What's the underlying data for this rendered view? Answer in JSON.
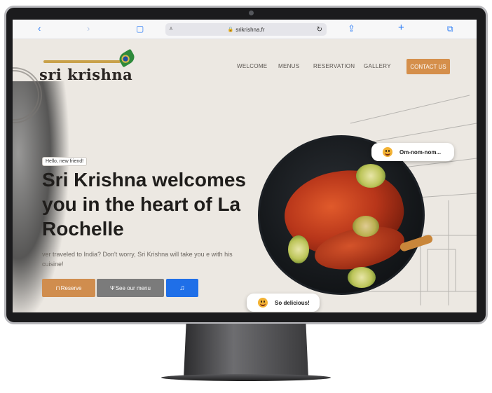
{
  "browser": {
    "url": "srikrishna.fr",
    "text_size_label": "A",
    "icons": [
      "back-icon",
      "forward-icon",
      "book-icon",
      "lock-icon",
      "reload-icon",
      "share-icon",
      "plus-icon",
      "tabs-icon"
    ]
  },
  "site": {
    "logo_text": "sri krishna",
    "nav": [
      "WELCOME",
      "MENUS",
      "RESERVATION",
      "GALLERY"
    ],
    "contact_label": "CONTACT US"
  },
  "hero": {
    "badge": "Hello, new friend!",
    "headline": "Sri Krishna welcomes you in the heart of La Rochelle",
    "subtitle": "ver traveled to India? Don't worry, Sri Krishna will take you e with his cuisine!",
    "reserve_label": "Reserve",
    "menu_label": "See our menu",
    "music_icon": "♫"
  },
  "bubbles": {
    "top": "Om-nom-nom...",
    "bottom": "So delicious!"
  },
  "colors": {
    "accent": "#d58f4b",
    "music_button": "#1f6fe8",
    "menu_button": "#7b7b7b",
    "page_bg": "#ece8e2"
  }
}
